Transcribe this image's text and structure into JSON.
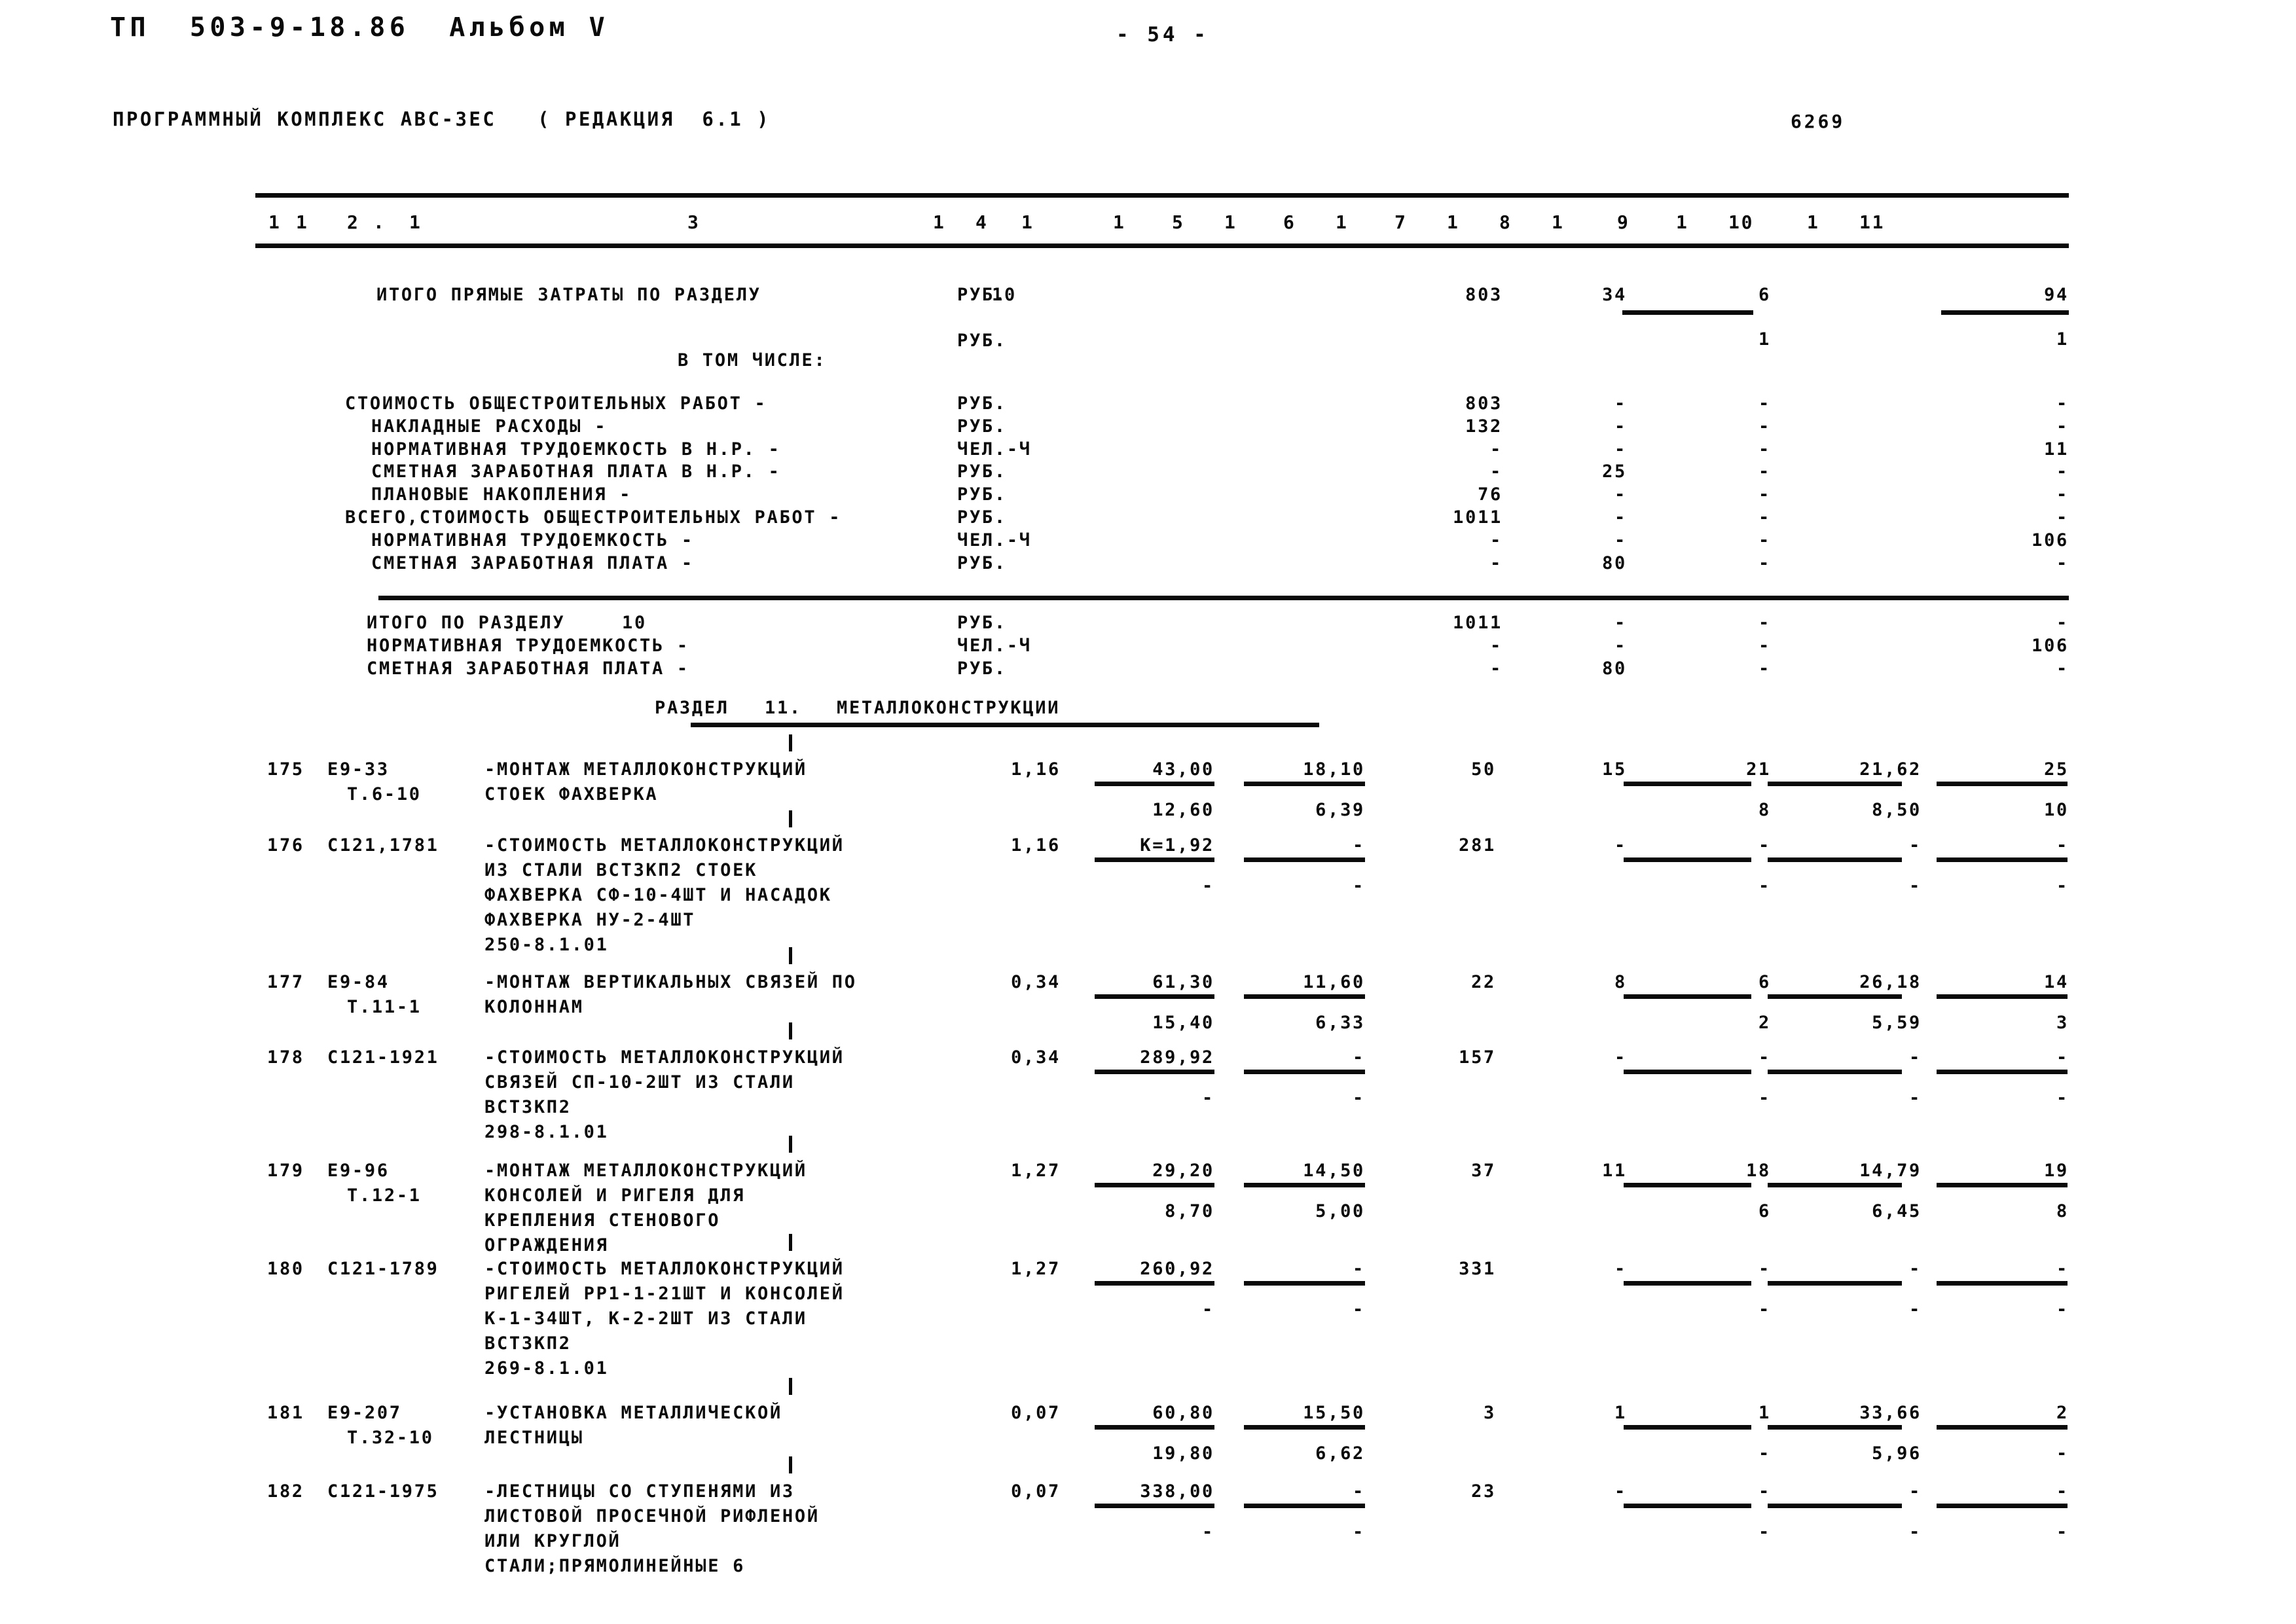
{
  "document": {
    "header_left": "ТП  503-9-18.86  Альбом V",
    "header_sub": "ПРОГРАММНЫЙ КОМПЛЕКС АВС-ЗЕС   ( РЕДАКЦИЯ  6.1 )",
    "page_number": "- 54 -",
    "right_code": "6269"
  },
  "table": {
    "column_numbers": [
      "1",
      "2",
      "3",
      "4",
      "5",
      "6",
      "7",
      "8",
      "9",
      "10",
      "11"
    ]
  },
  "summary_prev_section": {
    "total_direct_label": "ИТОГО ПРЯМЫЕ ЗАТРАТЫ ПО РАЗДЕЛУ",
    "total_direct_section": "10",
    "unit_rub": "РУБ.",
    "total_direct_values": {
      "c7": "803",
      "c8": "34",
      "c9": "6",
      "c11": "94"
    },
    "total_direct_sub_values": {
      "c9": "1",
      "c11": "1"
    },
    "in_which_label": "В ТОМ ЧИСЛЕ:",
    "rows": [
      {
        "label": "СТОИМОСТЬ ОБЩЕСТРОИТЕЛЬНЫХ РАБОТ -",
        "unit": "РУБ.",
        "indent": 0,
        "c7": "803",
        "c8": "-",
        "c9": "-",
        "c11": "-"
      },
      {
        "label": "НАКЛАДНЫЕ РАСХОДЫ -",
        "unit": "РУБ.",
        "indent": 1,
        "c7": "132",
        "c8": "-",
        "c9": "-",
        "c11": "-"
      },
      {
        "label": "НОРМАТИВНАЯ ТРУДОЕМКОСТЬ В Н.Р. -",
        "unit": "ЧЕЛ.-Ч",
        "indent": 1,
        "c7": "-",
        "c8": "-",
        "c9": "-",
        "c11": "11"
      },
      {
        "label": "СМЕТНАЯ ЗАРАБОТНАЯ ПЛАТА В Н.Р. -",
        "unit": "РУБ.",
        "indent": 1,
        "c7": "-",
        "c8": "25",
        "c9": "-",
        "c11": "-"
      },
      {
        "label": "ПЛАНОВЫЕ НАКОПЛЕНИЯ -",
        "unit": "РУБ.",
        "indent": 1,
        "c7": "76",
        "c8": "-",
        "c9": "-",
        "c11": "-"
      },
      {
        "label": "ВСЕГО,СТОИМОСТЬ ОБЩЕСТРОИТЕЛЬНЫХ РАБОТ -",
        "unit": "РУБ.",
        "indent": 0,
        "c7": "1011",
        "c8": "-",
        "c9": "-",
        "c11": "-"
      },
      {
        "label": "НОРМАТИВНАЯ ТРУДОЕМКОСТЬ -",
        "unit": "ЧЕЛ.-Ч",
        "indent": 1,
        "c7": "-",
        "c8": "-",
        "c9": "-",
        "c11": "106"
      },
      {
        "label": "СМЕТНАЯ ЗАРАБОТНАЯ ПЛАТА -",
        "unit": "РУБ.",
        "indent": 1,
        "c7": "-",
        "c8": "80",
        "c9": "-",
        "c11": "-"
      }
    ],
    "totals": [
      {
        "label": "ИТОГО ПО РАЗДЕЛУ",
        "section": "10",
        "unit": "РУБ.",
        "c7": "1011",
        "c8": "-",
        "c9": "-",
        "c11": "-"
      },
      {
        "label": "НОРМАТИВНАЯ ТРУДОЕМКОСТЬ -",
        "section": "",
        "unit": "ЧЕЛ.-Ч",
        "c7": "-",
        "c8": "-",
        "c9": "-",
        "c11": "106"
      },
      {
        "label": "СМЕТНАЯ ЗАРАБОТНАЯ ПЛАТА -",
        "section": "",
        "unit": "РУБ.",
        "c7": "-",
        "c8": "80",
        "c9": "-",
        "c11": "-"
      }
    ]
  },
  "section": {
    "title_label": "РАЗДЕЛ",
    "title_number": "11.",
    "title_name": "МЕТАЛЛОКОНСТРУКЦИИ"
  },
  "items": [
    {
      "no": "175",
      "code1": "Е9-33",
      "code2": "Т.6-10",
      "desc": [
        "-МОНТАЖ МЕТАЛЛОКОНСТРУКЦИЙ",
        "СТОЕК ФАХВЕРКА"
      ],
      "c4": "1,16",
      "c5": "43,00",
      "c6": "18,10",
      "c7": "50",
      "c8": "15",
      "c9": "21",
      "c10": "21,62",
      "c11": "25",
      "sub_c5": "12,60",
      "sub_c6": "6,39",
      "sub_c9": "8",
      "sub_c10": "8,50",
      "sub_c11": "10"
    },
    {
      "no": "176",
      "code1": "С121,1781",
      "code2": "",
      "desc": [
        "-СТОИМОСТЬ МЕТАЛЛОКОНСТРУКЦИЙ",
        "ИЗ СТАЛИ ВСТ3КП2 СТОЕК",
        "ФАХВЕРКА СФ-10-4ШТ И НАСАДОК",
        "ФАХВЕРКА НУ-2-4ШТ",
        "250-8.1.01"
      ],
      "c4": "1,16",
      "c5": "К=1,92",
      "c6": "-",
      "c7": "281",
      "c8": "-",
      "c9": "-",
      "c10": "-",
      "c11": "-",
      "sub_c5": "-",
      "sub_c6": "-",
      "sub_c9": "-",
      "sub_c10": "-",
      "sub_c11": "-"
    },
    {
      "no": "177",
      "code1": "Е9-84",
      "code2": "Т.11-1",
      "desc": [
        "-МОНТАЖ ВЕРТИКАЛЬНЫХ СВЯЗЕЙ ПО",
        "КОЛОННАМ"
      ],
      "c4": "0,34",
      "c5": "61,30",
      "c6": "11,60",
      "c7": "22",
      "c8": "8",
      "c9": "6",
      "c10": "26,18",
      "c11": "14",
      "sub_c5": "15,40",
      "sub_c6": "6,33",
      "sub_c9": "2",
      "sub_c10": "5,59",
      "sub_c11": "3"
    },
    {
      "no": "178",
      "code1": "С121-1921",
      "code2": "",
      "desc": [
        "-СТОИМОСТЬ МЕТАЛЛОКОНСТРУКЦИЙ",
        "СВЯЗЕЙ СП-10-2ШТ ИЗ СТАЛИ",
        "ВСТ3КП2",
        "298-8.1.01"
      ],
      "c4": "0,34",
      "c5": "289,92",
      "c6": "-",
      "c7": "157",
      "c8": "-",
      "c9": "-",
      "c10": "-",
      "c11": "-",
      "sub_c5": "-",
      "sub_c6": "-",
      "sub_c9": "-",
      "sub_c10": "-",
      "sub_c11": "-"
    },
    {
      "no": "179",
      "code1": "Е9-96",
      "code2": "Т.12-1",
      "desc": [
        "-МОНТАЖ МЕТАЛЛОКОНСТРУКЦИЙ",
        "КОНСОЛЕЙ И РИГЕЛЯ ДЛЯ",
        "КРЕПЛЕНИЯ СТЕНОВОГО",
        "ОГРАЖДЕНИЯ"
      ],
      "c4": "1,27",
      "c5": "29,20",
      "c6": "14,50",
      "c7": "37",
      "c8": "11",
      "c9": "18",
      "c10": "14,79",
      "c11": "19",
      "sub_c5": "8,70",
      "sub_c6": "5,00",
      "sub_c9": "6",
      "sub_c10": "6,45",
      "sub_c11": "8"
    },
    {
      "no": "180",
      "code1": "С121-1789",
      "code2": "",
      "desc": [
        "-СТОИМОСТЬ МЕТАЛЛОКОНСТРУКЦИЙ",
        "РИГЕЛЕЙ РР1-1-21ШТ И КОНСОЛЕЙ",
        "К-1-34ШТ, К-2-2ШТ ИЗ СТАЛИ",
        "ВСТ3КП2",
        "269-8.1.01"
      ],
      "c4": "1,27",
      "c5": "260,92",
      "c6": "-",
      "c7": "331",
      "c8": "-",
      "c9": "-",
      "c10": "-",
      "c11": "-",
      "sub_c5": "-",
      "sub_c6": "-",
      "sub_c9": "-",
      "sub_c10": "-",
      "sub_c11": "-"
    },
    {
      "no": "181",
      "code1": "Е9-207",
      "code2": "Т.32-10",
      "desc": [
        "-УСТАНОВКА МЕТАЛЛИЧЕСКОЙ",
        "ЛЕСТНИЦЫ"
      ],
      "c4": "0,07",
      "c5": "60,80",
      "c6": "15,50",
      "c7": "3",
      "c8": "1",
      "c9": "1",
      "c10": "33,66",
      "c11": "2",
      "sub_c5": "19,80",
      "sub_c6": "6,62",
      "sub_c9": "-",
      "sub_c10": "5,96",
      "sub_c11": "-"
    },
    {
      "no": "182",
      "code1": "С121-1975",
      "code2": "",
      "desc": [
        "-ЛЕСТНИЦЫ СО СТУПЕНЯМИ ИЗ",
        "ЛИСТОВОЙ ПРОСЕЧНОЙ РИФЛЕНОЙ",
        "ИЛИ КРУГЛОЙ",
        "СТАЛИ;ПРЯМОЛИНЕЙНЫЕ 6"
      ],
      "c4": "0,07",
      "c5": "338,00",
      "c6": "-",
      "c7": "23",
      "c8": "-",
      "c9": "-",
      "c10": "-",
      "c11": "-",
      "sub_c5": "-",
      "sub_c6": "-",
      "sub_c9": "-",
      "sub_c10": "-",
      "sub_c11": "-"
    }
  ]
}
